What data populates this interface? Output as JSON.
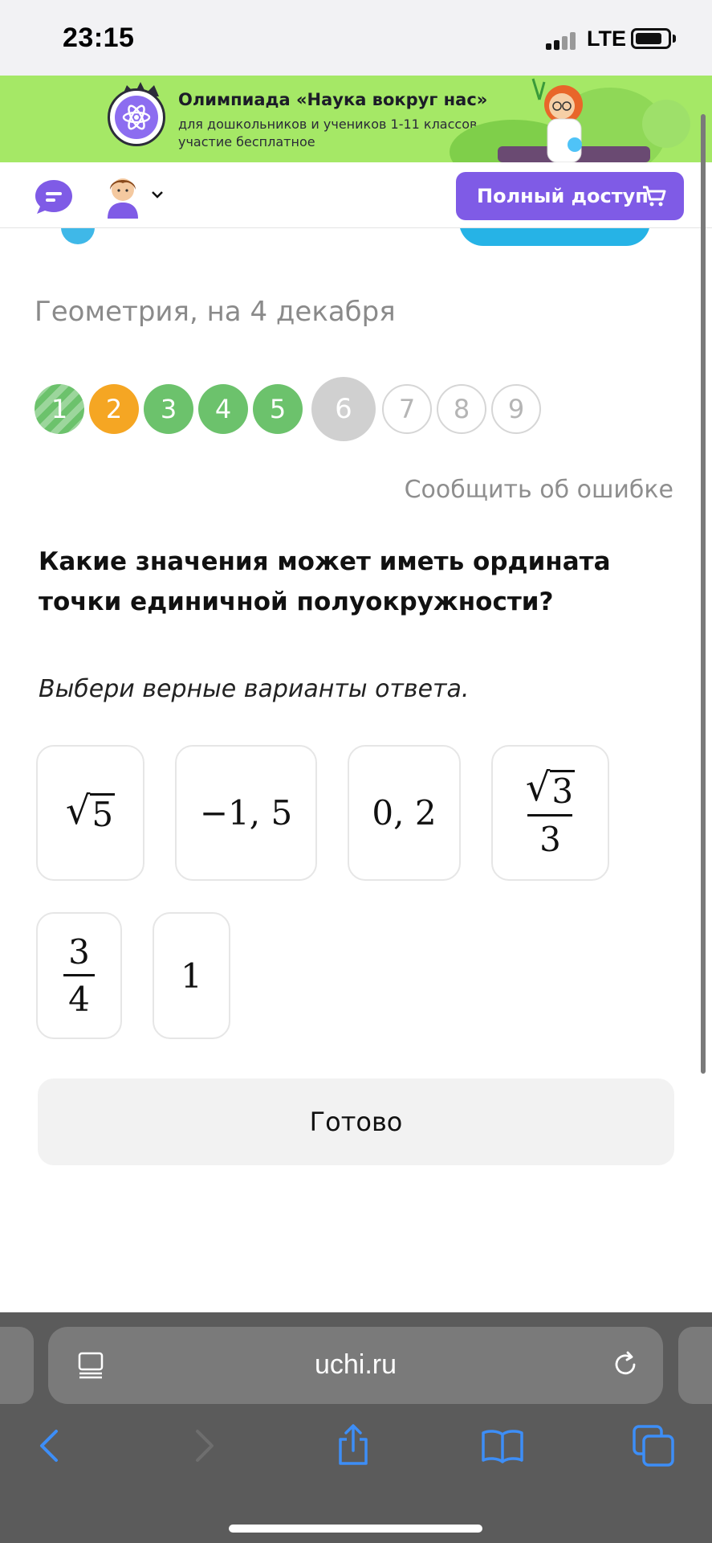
{
  "status_bar": {
    "time": "23:15",
    "network": "LTE"
  },
  "banner": {
    "title": "Олимпиада «Наука вокруг нас»",
    "subtitle_line1": "для дошкольников и учеников 1-11 классов",
    "subtitle_line2": "участие бесплатное"
  },
  "header": {
    "access_button_label": "Полный доступ"
  },
  "lesson": {
    "title": "Геометрия, на 4 декабря",
    "steps": [
      {
        "label": "1",
        "state": "done-striped"
      },
      {
        "label": "2",
        "state": "warning"
      },
      {
        "label": "3",
        "state": "done"
      },
      {
        "label": "4",
        "state": "done"
      },
      {
        "label": "5",
        "state": "done"
      },
      {
        "label": "6",
        "state": "current"
      },
      {
        "label": "7",
        "state": "todo"
      },
      {
        "label": "8",
        "state": "todo"
      },
      {
        "label": "9",
        "state": "todo"
      }
    ],
    "report_link": "Сообщить об ошибке"
  },
  "question": {
    "text": "Какие значения может иметь ордината точки единичной полуокружности?",
    "hint": "Выбери верные варианты ответа.",
    "options": [
      {
        "kind": "sqrt",
        "radicand": "5"
      },
      {
        "kind": "text",
        "text": "−1, 5"
      },
      {
        "kind": "text",
        "text": "0, 2"
      },
      {
        "kind": "sqrt-frac",
        "radicand": "3",
        "denominator": "3"
      },
      {
        "kind": "frac",
        "numerator": "3",
        "denominator": "4"
      },
      {
        "kind": "text",
        "text": "1"
      }
    ]
  },
  "done_button_label": "Готово",
  "browser": {
    "url": "uchi.ru"
  },
  "colors": {
    "banner": "#a5e866",
    "accent": "#7f5be6",
    "step_done": "#6cc26c",
    "step_warning": "#f5a623",
    "step_current": "#d0d0d0",
    "ios_blue": "#3d8ef7"
  }
}
